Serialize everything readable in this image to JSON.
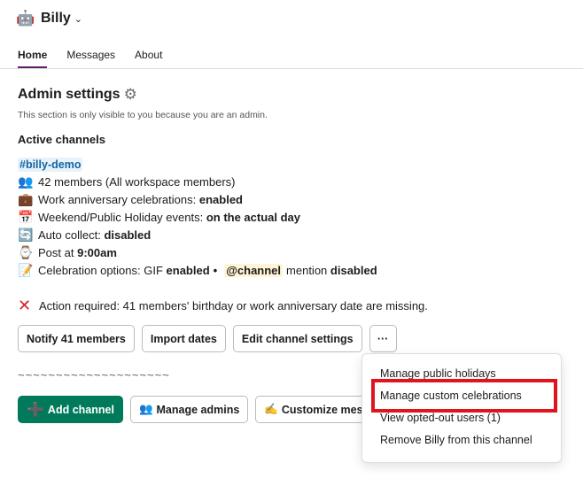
{
  "app": {
    "name": "Billy",
    "icon": "robot-icon"
  },
  "tabs": [
    {
      "label": "Home",
      "active": true
    },
    {
      "label": "Messages",
      "active": false
    },
    {
      "label": "About",
      "active": false
    }
  ],
  "admin": {
    "title": "Admin settings",
    "note": "This section is only visible to you because you are an admin.",
    "active_channels_label": "Active channels",
    "channel": "#billy-demo",
    "members_text": "42 members (All workspace members)",
    "anniversary_label": "Work anniversary celebrations:",
    "anniversary_value": "enabled",
    "holiday_label": "Weekend/Public Holiday events:",
    "holiday_value": "on the actual day",
    "autocollect_label": "Auto collect:",
    "autocollect_value": "disabled",
    "post_label": "Post at",
    "post_value": "9:00am",
    "celebration_label": "Celebration options: GIF",
    "celebration_gif_value": "enabled",
    "celebration_bullet": "•",
    "celebration_mention": "@channel",
    "celebration_mention_text": "mention",
    "celebration_mention_value": "disabled",
    "action_text": "Action required: 41 members' birthday or work anniversary date are missing."
  },
  "buttons": {
    "notify": "Notify 41 members",
    "import": "Import dates",
    "edit": "Edit channel settings",
    "more": "···"
  },
  "divider_text": "~~~~~~~~~~~~~~~~~~~~",
  "bottom_buttons": {
    "add_channel": "Add channel",
    "manage_admins": "Manage admins",
    "customize": "Customize mess"
  },
  "menu": {
    "items": [
      "Manage public holidays",
      "Manage custom celebrations",
      "View opted-out users (1)",
      "Remove Billy from this channel"
    ]
  },
  "colors": {
    "accent": "#611f69",
    "primary_button": "#007a5a",
    "link": "#1264a3",
    "highlight": "#e0141e"
  }
}
